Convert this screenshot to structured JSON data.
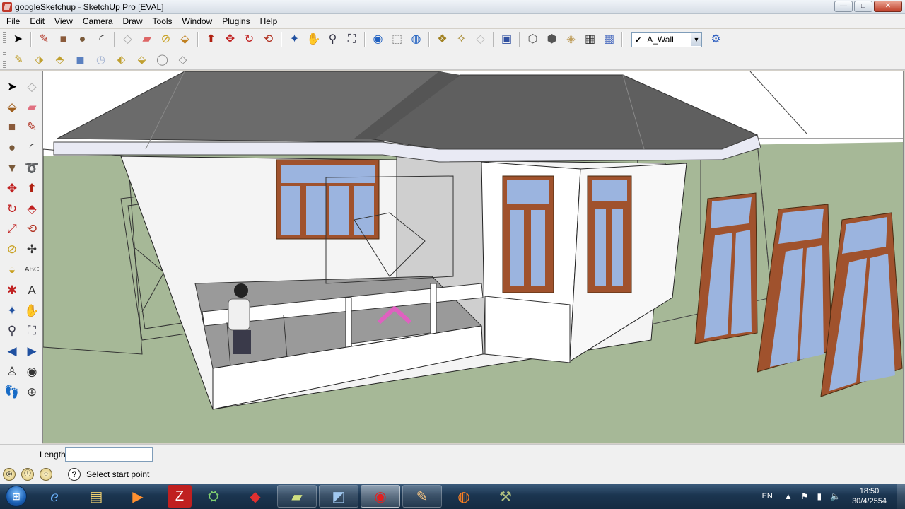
{
  "window": {
    "title": "googleSketchup - SketchUp Pro [EVAL]",
    "controls": [
      "minimize",
      "maximize",
      "close"
    ],
    "control_glyphs": {
      "minimize": "—",
      "maximize": "□",
      "close": "✕"
    }
  },
  "menu": [
    "File",
    "Edit",
    "View",
    "Camera",
    "Draw",
    "Tools",
    "Window",
    "Plugins",
    "Help"
  ],
  "toolbar_main": {
    "icons": [
      "select-icon",
      "line-icon",
      "rectangle-icon",
      "circle-icon",
      "arc-icon",
      "make-component-icon",
      "eraser-icon",
      "tape-measure-icon",
      "paint-bucket-icon",
      "push-pull-icon",
      "move-icon",
      "rotate-icon",
      "offset-icon",
      "orbit-icon",
      "pan-icon",
      "zoom-icon",
      "zoom-extents-icon",
      "get-models-icon",
      "share-model-icon",
      "place-model-icon",
      "get-photo-texture-icon",
      "share-component-icon",
      "preview-in-google-earth-icon",
      "xray-style-icon",
      "wireframe-style-icon",
      "hidden-line-style-icon",
      "shaded-style-icon",
      "shaded-textures-style-icon",
      "monochrome-style-icon"
    ],
    "layer": {
      "selected": "A_Wall",
      "checked": true
    }
  },
  "toolbar_secondary": {
    "icons": [
      "sandbox-from-contours-icon",
      "sandbox-from-scratch-icon",
      "smoove-icon",
      "stamp-icon",
      "drape-icon",
      "add-detail-icon",
      "flip-edge-icon",
      "circle-gear-icon",
      "diamond-icon"
    ]
  },
  "left_toolbar": {
    "icons": [
      [
        "select-icon",
        "component-icon"
      ],
      [
        "paint-bucket-icon",
        "eraser-icon"
      ],
      [
        "rectangle-icon",
        "line-icon"
      ],
      [
        "circle-icon",
        "arc-icon"
      ],
      [
        "polygon-icon",
        "freehand-icon"
      ],
      [
        "move-icon",
        "push-pull-icon"
      ],
      [
        "rotate-icon",
        "follow-me-icon"
      ],
      [
        "scale-icon",
        "offset-icon"
      ],
      [
        "tape-measure-icon",
        "dimension-icon"
      ],
      [
        "protractor-icon",
        "text-icon"
      ],
      [
        "axes-icon",
        "3d-text-icon"
      ],
      [
        "orbit-icon",
        "pan-icon"
      ],
      [
        "zoom-icon",
        "zoom-window-icon"
      ],
      [
        "previous-view-icon",
        "next-view-icon"
      ],
      [
        "position-camera-icon",
        "look-around-icon"
      ],
      [
        "walk-icon",
        "section-plane-icon"
      ]
    ]
  },
  "measurements": {
    "label": "Length",
    "value": ""
  },
  "status": {
    "text": "Select start point",
    "help_glyph": "?"
  },
  "taskbar": {
    "apps": [
      "internet-explorer-icon",
      "file-explorer-icon",
      "media-player-icon",
      "filezilla-icon",
      "network-icon",
      "acrobat-icon",
      "sticky-notes-icon",
      "paint-icon",
      "sketchup-icon",
      "pencil-app-icon",
      "firefox-icon",
      "tool-app-icon"
    ],
    "active_app": "sketchup-icon",
    "tray": {
      "lang": "EN",
      "time": "18:50",
      "date": "30/4/2554"
    }
  },
  "colors": {
    "sky": "#ffffff",
    "ground": "#a6b897",
    "roof": "#6b6b6b",
    "window_frame": "#a0522d",
    "glass": "#9bb4df",
    "wall": "#ffffff",
    "taskbar": "#1b3550"
  }
}
